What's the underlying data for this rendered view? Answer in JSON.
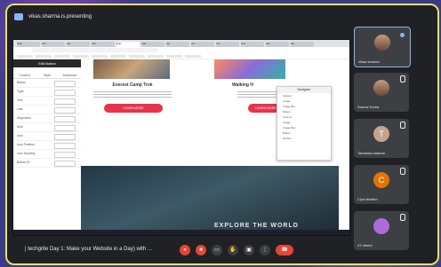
{
  "meet_window": {
    "title": "vikas.sharma.is.presenting",
    "accent": "#e9e35a"
  },
  "shared_screen": {
    "browser_tabs": [
      "Web",
      "Pro",
      "Ind",
      "Wh",
      "Edit",
      "Stat",
      "My",
      "Gri",
      "Ind",
      "Ann",
      "Glo",
      "Mo"
    ],
    "address": "",
    "elementor_panel": {
      "header": "Edit Button",
      "tabs": [
        "Content",
        "Style",
        "Advanced"
      ],
      "rows": [
        "Button",
        "Type",
        "Text",
        "Link",
        "Alignment",
        "Size",
        "Icon",
        "Icon Position",
        "Icon Spacing",
        "Button ID"
      ]
    },
    "cards": [
      {
        "title": "Everest Camp Trek",
        "button": "LEARN MORE"
      },
      {
        "title": "Walking H",
        "button": "LEARN MORE"
      }
    ],
    "hero_title": "EXPLORE THE WORLD",
    "navigator": {
      "title": "Navigator",
      "items": [
        "Section",
        "Image",
        "Image Box",
        "Button",
        "Column",
        "Image",
        "Image Box",
        "Button",
        "Section"
      ]
    }
  },
  "participants": [
    {
      "name": "vikas sharma",
      "initial": "",
      "avatar_color": "",
      "photo": true
    },
    {
      "name": "Sourav Kuma",
      "initial": "",
      "avatar_color": "",
      "photo": true
    },
    {
      "name": "Tamanna sharma",
      "initial": "T",
      "avatar_color": "#c5a48e",
      "photo": false
    },
    {
      "name": "Ciya Modern",
      "initial": "C",
      "avatar_color": "#e37400",
      "photo": false
    },
    {
      "name": "47 others",
      "initial": "",
      "avatar_color": "#b06ad9",
      "photo": false
    }
  ],
  "bottom_bar": {
    "meeting_title": "| techgrite Day 1: Make your Website in a Day) with ...",
    "controls": [
      "mic-off",
      "camera-off",
      "captions",
      "raise-hand",
      "present",
      "more",
      "end-call"
    ]
  }
}
